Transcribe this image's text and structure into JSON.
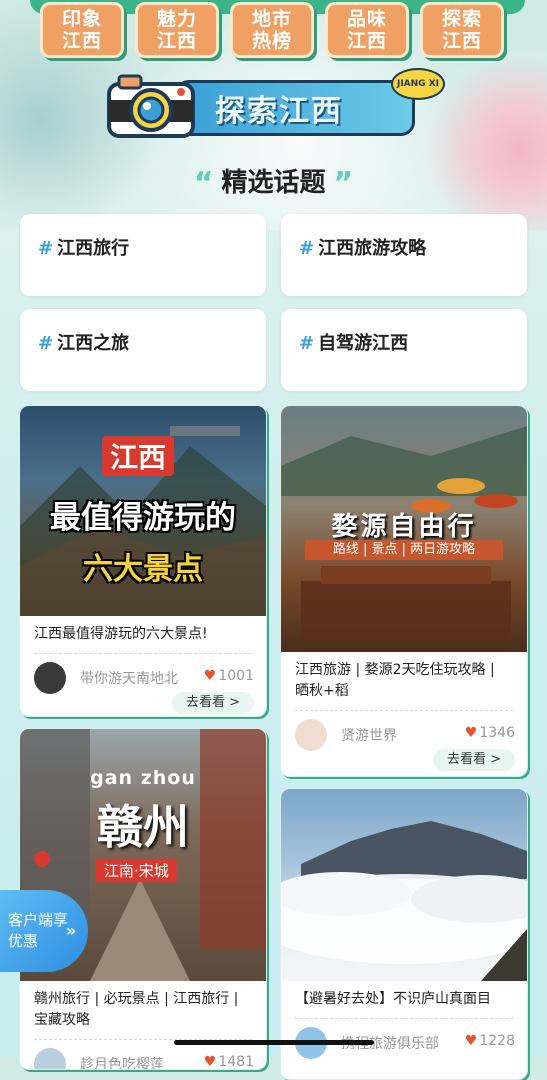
{
  "top_tabs": [
    "印象江西",
    "魅力江西",
    "地市热榜",
    "品味江西",
    "探索江西"
  ],
  "banner": {
    "title": "探索江西",
    "badge": "JIANG XI"
  },
  "section": {
    "quote_open": "“",
    "title": "精选话题",
    "quote_close": "”"
  },
  "topics": [
    {
      "hash": "#",
      "label": "江西旅行"
    },
    {
      "hash": "#",
      "label": "江西旅游攻略"
    },
    {
      "hash": "#",
      "label": "江西之旅"
    },
    {
      "hash": "#",
      "label": "自驾游江西"
    }
  ],
  "cards": [
    {
      "image_text": {
        "line1": "江西",
        "line2": "最值得游玩的",
        "line3": "六大景点"
      },
      "title": "江西最值得游玩的六大景点!",
      "author": "带你游天南地北",
      "likes": "1001",
      "button": "去看看 >"
    },
    {
      "image_text": {
        "line1": "婺源自由行",
        "line2": "路线 | 景点 | 两日游攻略"
      },
      "title": "江西旅游 | 婺源2天吃住玩攻略 | 晒秋+稻",
      "author": "贤游世界",
      "likes": "1346",
      "button": "去看看 >"
    },
    {
      "image_text": {
        "line1": "gan zhou",
        "line2": "赣州",
        "line3": "江南·宋城"
      },
      "title": "赣州旅行 | 必玩景点 | 江西旅行 | 宝藏攻略",
      "author": "趁月色吃樱莲",
      "likes": "1481"
    },
    {
      "image_text": {},
      "title": "【避暑好去处】不识庐山真面目",
      "author": "携程旅游俱乐部",
      "likes": "1228"
    }
  ],
  "float_button": {
    "label": "客户端享优惠",
    "arrow": "»"
  },
  "colors": {
    "accent_green": "#3cb389",
    "tab_orange": "#f0a062",
    "heart_red": "#e8532f",
    "hash_blue": "#3aa0d6"
  }
}
